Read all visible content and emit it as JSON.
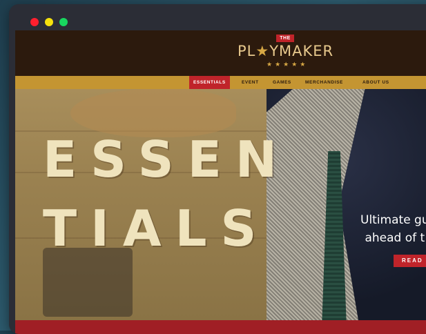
{
  "window": {
    "controls": [
      "close",
      "minimize",
      "maximize"
    ],
    "colors": {
      "close": "#ff1f2e",
      "minimize": "#f4e10d",
      "maximize": "#18d65f"
    }
  },
  "site": {
    "badge": "THE",
    "brand_left": "PL",
    "brand_star": "★",
    "brand_right": "YMAKER",
    "brand_stars": "★★★★★"
  },
  "nav": {
    "items": [
      {
        "label": "ESSENTIALS",
        "active": true
      },
      {
        "label": "EVENT",
        "active": false
      },
      {
        "label": "GAMES",
        "active": false
      },
      {
        "label": "MERCHANDISE",
        "active": false
      },
      {
        "label": "ABOUT US",
        "active": false
      }
    ]
  },
  "hero": {
    "headline_line1": "ESSEN",
    "headline_line2": "TIALS",
    "tagline_line1": "Ultimate gu",
    "tagline_line2": "ahead of t",
    "button": "READ T"
  },
  "colors": {
    "header_bg": "#2c1a0d",
    "nav_bg": "#c49532",
    "accent_red": "#c0242a",
    "headline": "#efe3bd"
  }
}
